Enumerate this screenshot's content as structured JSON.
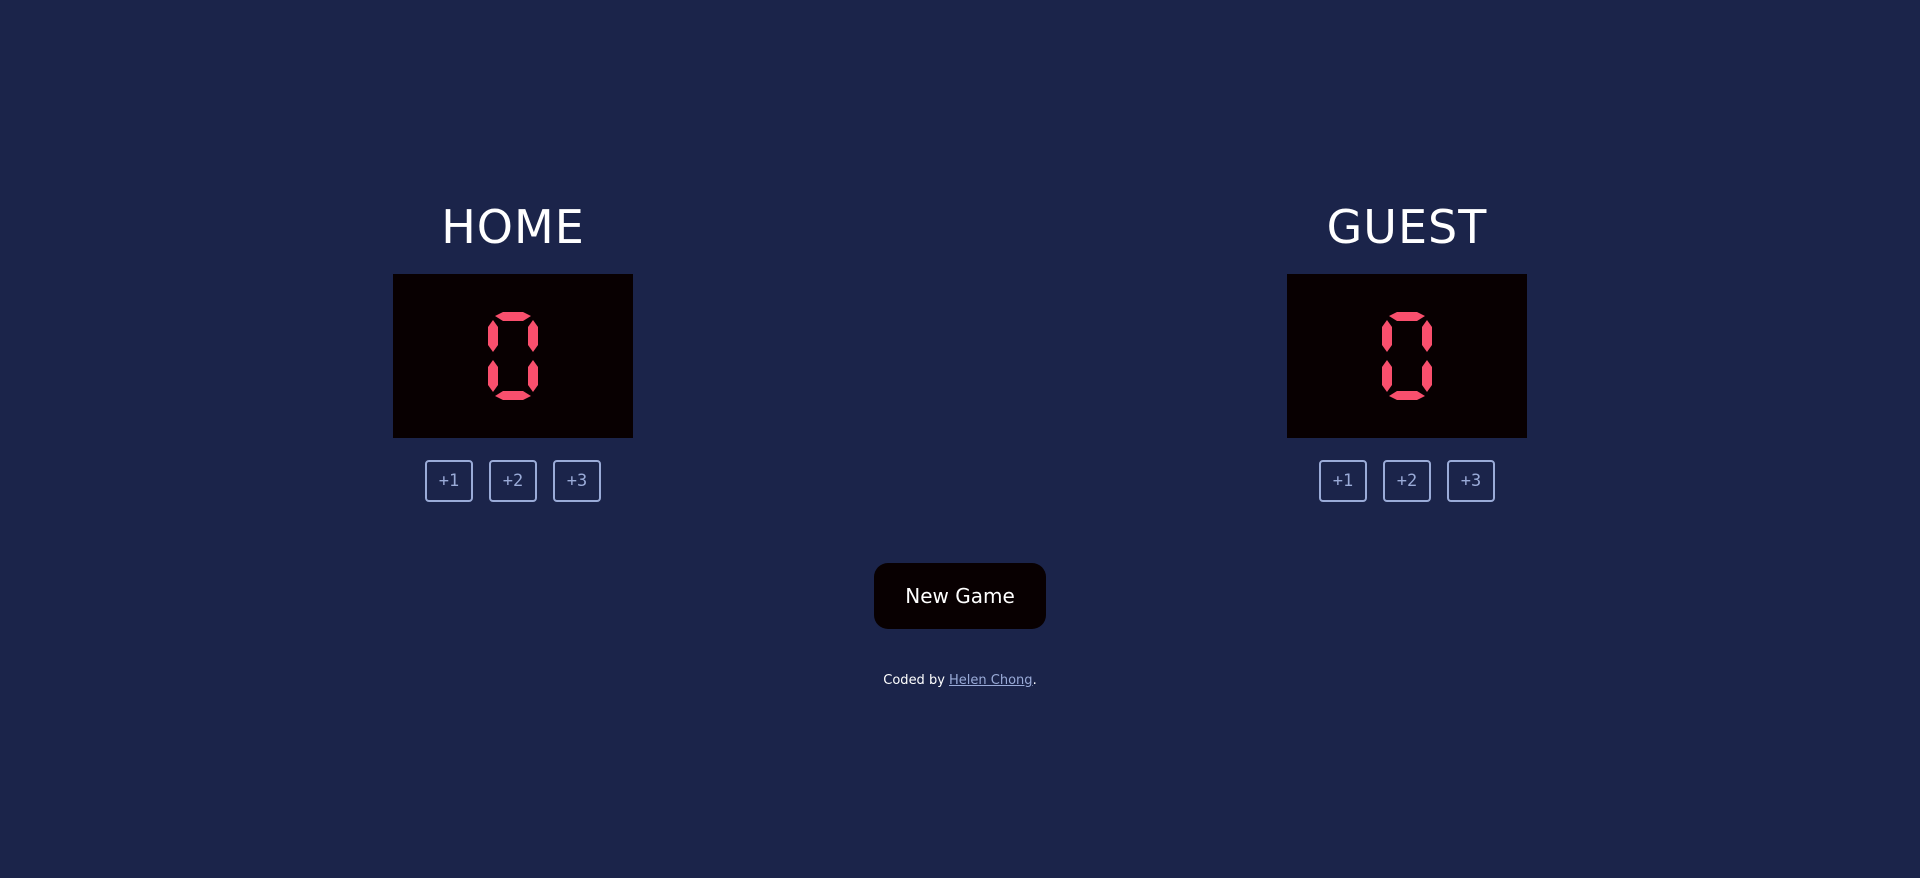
{
  "home": {
    "title": "HOME",
    "score": 0,
    "buttons": [
      "+1",
      "+2",
      "+3"
    ]
  },
  "guest": {
    "title": "GUEST",
    "score": 0,
    "buttons": [
      "+1",
      "+2",
      "+3"
    ]
  },
  "new_game_label": "New Game",
  "footer": {
    "prefix": "Coded by ",
    "author": "Helen Chong",
    "suffix": "."
  },
  "colors": {
    "background": "#1b244a",
    "display": "#080001",
    "digit": "#f94f6d",
    "button_outline": "#9aabd8"
  }
}
